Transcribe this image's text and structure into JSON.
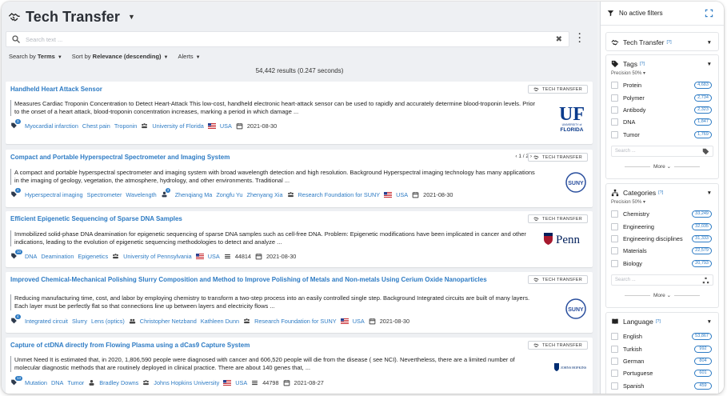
{
  "header": {
    "title": "Tech Transfer",
    "search_placeholder": "Search text ..."
  },
  "sortbar": {
    "search_by_prefix": "Search by",
    "search_by_value": "Terms",
    "sort_by_prefix": "Sort by",
    "sort_by_value": "Relevance (descending)",
    "alerts": "Alerts"
  },
  "results_count": "54,442 results (0.247 seconds)",
  "badge_label": "TECH TRANSFER",
  "cards": [
    {
      "title": "Handheld Heart Attack Sensor",
      "desc": "Measures Cardiac Troponin Concentration to Detect Heart-Attack This low-cost, handheld electronic heart-attack sensor can be used to rapidly and accurately determine blood-troponin levels. Prior to the onset of a heart attack, blood-troponin concentration increases, marking a period in which damage ...",
      "tag_count": "3",
      "tags": [
        "Myocardial infarction",
        "Chest pain",
        "Troponin"
      ],
      "org": "University of Florida",
      "country": "USA",
      "date": "2021-08-30",
      "logo": "UF"
    },
    {
      "title": "Compact and Portable Hyperspectral Spectrometer and Imaging System",
      "pager": "1 / 2",
      "desc": "A compact and portable hyperspectral spectrometer and imaging system with broad wavelength detection and high resolution. Background Hyperspectral imaging technology has many applications in the imaging of geology, vegetation, the atmosphere, hydrology, and other environments.  Traditional ...",
      "tag_count": "4",
      "tags": [
        "Hyperspectral imaging",
        "Spectrometer",
        "Wavelength"
      ],
      "people_count": "3",
      "people": [
        "Zhenqiang Ma",
        "Zongfu Yu",
        "Zhenyang Xia"
      ],
      "org": "Research Foundation for SUNY",
      "country": "USA",
      "date": "2021-08-30",
      "logo": "SUNY"
    },
    {
      "title": "Efficient Epigenetic Sequencing of Sparse DNA Samples",
      "desc": "Immobilized solid-phase DNA deamination for epigenetic sequencing of sparse DNA samples such as cell-free DNA.  Problem:  Epigenetic modifications have been implicated in cancer and other indications, leading to the evolution of epigenetic sequencing methodologies to detect and analyze ...",
      "tag_count": "10",
      "tags": [
        "DNA",
        "Deamination",
        "Epigenetics"
      ],
      "org": "University of Pennsylvania",
      "country": "USA",
      "id": "44814",
      "date": "2021-08-30",
      "logo": "Penn"
    },
    {
      "title": "Improved Chemical-Mechanical Polishing Slurry Composition and Method to Improve Polishing of Metals and Non-metals Using Cerium Oxide Nanoparticles",
      "desc": "Reducing manufacturing time, cost, and labor by employing chemistry to transform a two-step process into an easily controlled single step. Background Integrated circuits are built of many layers. Each layer must be perfectly flat so that connections line up between layers and electricity flows ...",
      "tag_count": "4",
      "tags": [
        "Integrated circuit",
        "Slurry",
        "Lens (optics)"
      ],
      "people": [
        "Christopher Netzband",
        "Kathleen Dunn"
      ],
      "org": "Research Foundation for SUNY",
      "country": "USA",
      "date": "2021-08-30",
      "logo": "SUNY"
    },
    {
      "title": "Capture of ctDNA directly from Flowing Plasma using a dCas9 Capture System",
      "desc": "Unmet Need It is estimated that, in 2020, 1,806,590 people were diagnosed with cancer and 606,520 people will die from the disease ( see NCI). Nevertheless, there are a limited number of molecular diagnostic methods that are routinely deployed in clinical practice. There are about 140 genes that, ...",
      "tag_count": "13",
      "tags": [
        "Mutation",
        "DNA",
        "Tumor"
      ],
      "people": [
        "Bradley Downs"
      ],
      "org": "Johns Hopkins University",
      "country": "USA",
      "id": "44798",
      "date": "2021-08-27",
      "logo": "JOHNS HOPKINS"
    }
  ],
  "sidebar": {
    "no_filters": "No active filters",
    "source_title": "Tech Transfer",
    "source_help": "[?]",
    "tags": {
      "title": "Tags",
      "help": "[?]",
      "precision": "Precision 50%",
      "items": [
        {
          "label": "Protein",
          "count": "4,683"
        },
        {
          "label": "Polymer",
          "count": "2,734"
        },
        {
          "label": "Antibody",
          "count": "2,323"
        },
        {
          "label": "DNA",
          "count": "1,847"
        },
        {
          "label": "Tumor",
          "count": "1,769"
        }
      ],
      "search_placeholder": "Search ...",
      "more": "More"
    },
    "categories": {
      "title": "Categories",
      "help": "[?]",
      "precision": "Precision 50%",
      "items": [
        {
          "label": "Chemistry",
          "count": "33,249"
        },
        {
          "label": "Engineering",
          "count": "32,035"
        },
        {
          "label": "Engineering disciplines",
          "count": "31,333"
        },
        {
          "label": "Materials",
          "count": "22,579"
        },
        {
          "label": "Biology",
          "count": "20,793"
        }
      ],
      "search_placeholder": "Search ...",
      "more": "More"
    },
    "language": {
      "title": "Language",
      "help": "[?]",
      "items": [
        {
          "label": "English",
          "count": "53,867"
        },
        {
          "label": "Turkish",
          "count": "992"
        },
        {
          "label": "German",
          "count": "804"
        },
        {
          "label": "Portuguese",
          "count": "601"
        },
        {
          "label": "Spanish",
          "count": "459"
        }
      ]
    }
  }
}
